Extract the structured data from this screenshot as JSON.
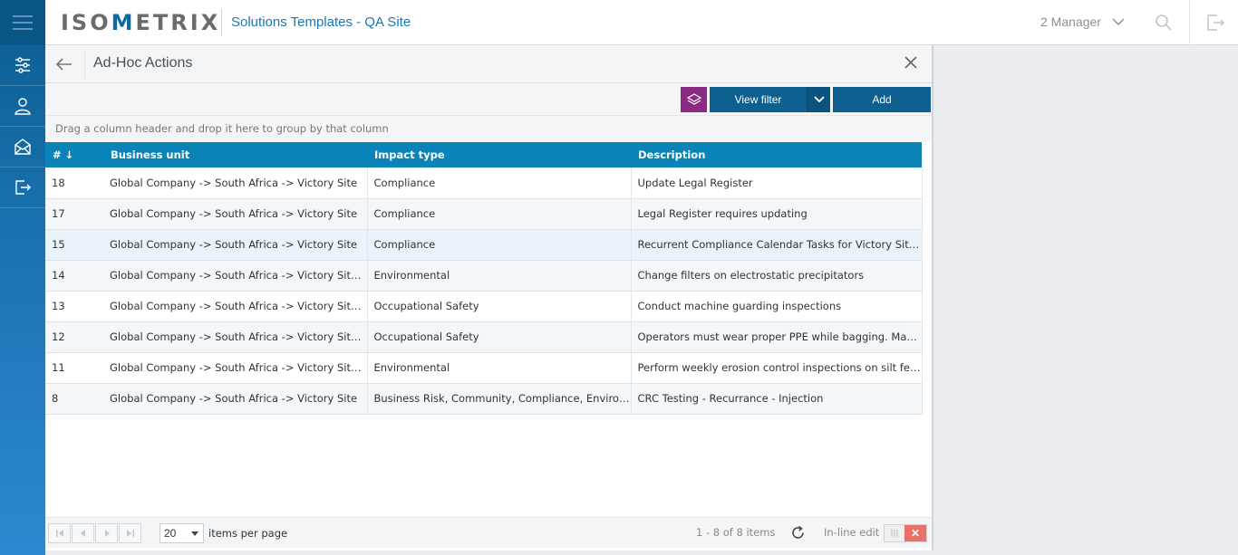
{
  "app": {
    "logo_text": "ISOMETRIX",
    "site_title": "Solutions Templates - QA Site",
    "user_label": "2 Manager"
  },
  "sidebar": {
    "items": [
      {
        "name": "sliders-icon"
      },
      {
        "name": "user-icon"
      },
      {
        "name": "mail-icon"
      },
      {
        "name": "logout-icon"
      }
    ]
  },
  "panel": {
    "title": "Ad-Hoc Actions",
    "toolbar": {
      "view_filter_label": "View filter",
      "add_label": "Add"
    },
    "group_hint": "Drag a column header and drop it here to group by that column"
  },
  "grid": {
    "columns": [
      "# ↓",
      "Business unit",
      "Impact type",
      "Description"
    ],
    "rows": [
      {
        "id": "18",
        "business_unit": "Global Company -> South Africa -> Victory Site",
        "impact_type": "Compliance",
        "description": "Update Legal Register"
      },
      {
        "id": "17",
        "business_unit": "Global Company -> South Africa -> Victory Site",
        "impact_type": "Compliance",
        "description": "Legal Register requires updating"
      },
      {
        "id": "15",
        "business_unit": "Global Company -> South Africa -> Victory Site",
        "impact_type": "Compliance",
        "description": "Recurrent Compliance Calendar Tasks for Victory Site..."
      },
      {
        "id": "14",
        "business_unit": "Global Company -> South Africa -> Victory Site...",
        "impact_type": "Environmental",
        "description": "Change filters on electrostatic precipitators"
      },
      {
        "id": "13",
        "business_unit": "Global Company -> South Africa -> Victory Site...",
        "impact_type": "Occupational Safety",
        "description": "Conduct machine guarding inspections"
      },
      {
        "id": "12",
        "business_unit": "Global Company -> South Africa -> Victory Site...",
        "impact_type": "Occupational Safety",
        "description": "Operators must wear proper PPE while bagging. Man..."
      },
      {
        "id": "11",
        "business_unit": "Global Company -> South Africa -> Victory Site...",
        "impact_type": "Environmental",
        "description": "Perform weekly erosion control inspections on silt fen..."
      },
      {
        "id": "8",
        "business_unit": "Global Company -> South Africa -> Victory Site",
        "impact_type": "Business Risk, Community, Compliance, Environ...",
        "description": "CRC Testing - Recurrance - Injection"
      }
    ],
    "selected_row_id": "15"
  },
  "pager": {
    "page_size": "20",
    "items_per_page_label": "items per page",
    "info": "1 - 8 of 8 items",
    "inline_edit_label": "In-line edit",
    "inline_edit_enabled": false
  },
  "colors": {
    "header_blue": "#0a84b8",
    "button_blue": "#0d5f8f",
    "layers_purple": "#8b2a82",
    "toggle_red": "#e8716a"
  }
}
